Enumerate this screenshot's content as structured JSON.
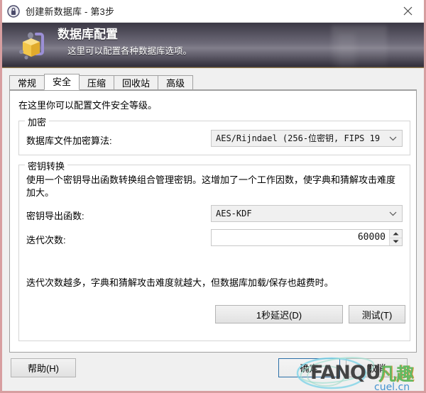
{
  "window": {
    "title": "创建新数据库 - 第3步",
    "app_icon": "lock-icon",
    "close_label": "✕",
    "border_color": "#d79ea0"
  },
  "banner": {
    "icon": "database-lock-icon",
    "title": "数据库配置",
    "subtitle": "这里可以配置各种数据库选项。",
    "accent_color": "#b99a52"
  },
  "tabs": [
    {
      "label": "常规",
      "selected": false
    },
    {
      "label": "安全",
      "selected": true
    },
    {
      "label": "压缩",
      "selected": false
    },
    {
      "label": "回收站",
      "selected": false
    },
    {
      "label": "高级",
      "selected": false
    }
  ],
  "security_tab": {
    "intro": "在这里你可以配置文件安全等级。",
    "encryption_group": {
      "legend": "加密",
      "algorithm_label": "数据库文件加密算法:",
      "algorithm_value": "AES/Rijndael (256-位密钥, FIPS 19",
      "algorithm_arrow": "chevron-down-icon"
    },
    "key_transform_group": {
      "legend": "密钥转换",
      "description": "使用一个密钥导出函数转换组合管理密钥。这增加了一个工作因数，使字典和猜解攻击难度加大。",
      "kdf_label": "密钥导出函数:",
      "kdf_value": "AES-KDF",
      "kdf_arrow": "chevron-down-icon",
      "iterations_label": "迭代次数:",
      "iterations_value": "60000",
      "spin_up": "spinner-up-icon",
      "spin_down": "spinner-down-icon",
      "hint": "迭代次数越多，字典和猜解攻击难度就越大，但数据库加载/保存也越费时。",
      "delay_button": "1秒延迟(D)",
      "test_button": "测试(T)"
    }
  },
  "footer": {
    "help_button": "帮助(H)",
    "ok_button": "确定",
    "cancel_button": "取消",
    "ok_focus_color": "#2c6fa8"
  },
  "watermark": {
    "brand_latin": "FANQU",
    "brand_cn": "凡趣",
    "url": "cuel.cn",
    "cn_color": "#5cb85c",
    "url_color": "#3d8fd0"
  }
}
